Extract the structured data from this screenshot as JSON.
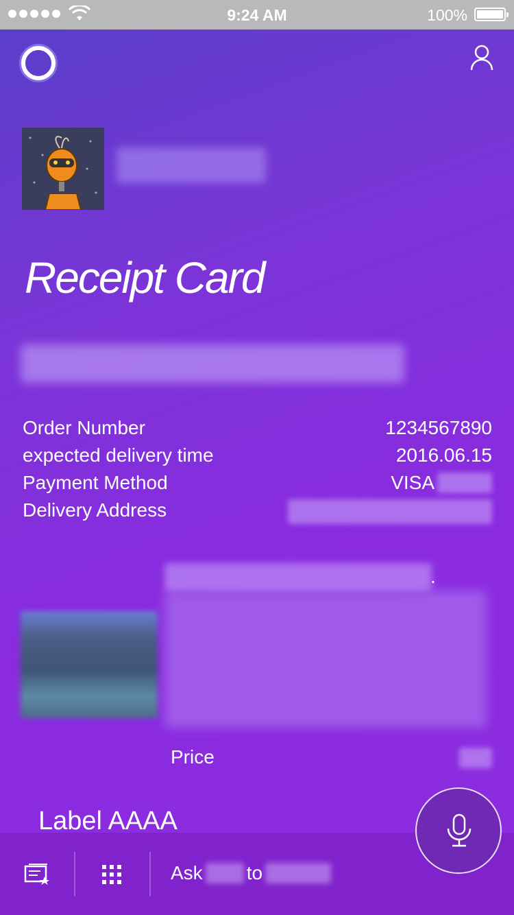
{
  "status_bar": {
    "time": "9:24 AM",
    "battery_percent": "100%"
  },
  "card": {
    "title": "Receipt Card",
    "facts": [
      {
        "key": "Order Number",
        "value": "1234567890"
      },
      {
        "key": "expected delivery time",
        "value": "2016.06.15"
      },
      {
        "key": "Payment Method",
        "value": "VISA"
      },
      {
        "key": "Delivery Address",
        "value": ""
      }
    ],
    "item": {
      "title_suffix": "."
    },
    "price_label": "Price",
    "footer_label": "Label AAAA"
  },
  "bottom_bar": {
    "ask_text": "Ask",
    "to_text": "to"
  },
  "colors": {
    "status_bar_bg": "#b9b9bb",
    "accent": "#8a2be0",
    "mic_button": "#6f29b4"
  },
  "icons": [
    "wifi-icon",
    "battery-icon",
    "cortana-icon",
    "profile-icon",
    "notebook-icon",
    "grid-icon",
    "mic-icon"
  ]
}
